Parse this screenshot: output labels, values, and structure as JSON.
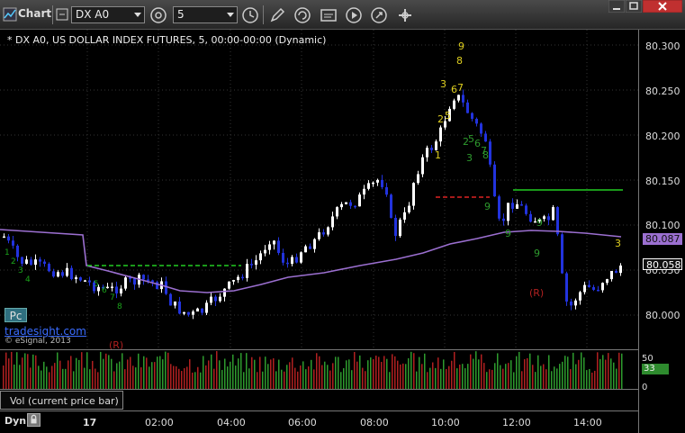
{
  "toolbar": {
    "title": "Chart",
    "symbol": "DX A0",
    "interval": "5"
  },
  "chart": {
    "header": "* DX A0, US DOLLAR INDEX FUTURES, 5, 00:00-00:00 (Dynamic)",
    "price_labels": [
      "80.300",
      "80.250",
      "80.200",
      "80.150",
      "80.100",
      "80.050",
      "80.000"
    ],
    "last_price_tag": "80.058",
    "ma_price_tag": "80.087",
    "pc_label": "Pc",
    "brand_link": "tradesight.com",
    "brand_copy": "© eSignal, 2013",
    "markers": [
      {
        "text": "9",
        "color": "#e0d020"
      },
      {
        "text": "8",
        "color": "#e0d020"
      },
      {
        "text": "3",
        "color": "#e0d020"
      },
      {
        "text": "6",
        "color": "#e0d020"
      },
      {
        "text": "7",
        "color": "#e0d020"
      },
      {
        "text": "2",
        "color": "#e0d020"
      },
      {
        "text": "5",
        "color": "#e0d020"
      },
      {
        "text": "1",
        "color": "#e0d020"
      },
      {
        "text": "2",
        "color": "#2e9b2e"
      },
      {
        "text": "5",
        "color": "#2e9b2e"
      },
      {
        "text": "6",
        "color": "#2e9b2e"
      },
      {
        "text": "7",
        "color": "#2e9b2e"
      },
      {
        "text": "8",
        "color": "#2e9b2e"
      },
      {
        "text": "3",
        "color": "#2e9b2e"
      },
      {
        "text": "9",
        "color": "#2e9b2e"
      },
      {
        "text": "9",
        "color": "#2e9b2e"
      },
      {
        "text": "9",
        "color": "#2e9b2e"
      },
      {
        "text": "9",
        "color": "#2e9b2e"
      },
      {
        "text": "3",
        "color": "#e0d020"
      },
      {
        "text": "(R)",
        "color": "#b02020"
      },
      {
        "text": "(R)",
        "color": "#b02020"
      }
    ]
  },
  "volume": {
    "label": "Vol (current price bar)",
    "scale": [
      "50",
      "0"
    ],
    "current": "33"
  },
  "time_axis": {
    "labels": [
      "17",
      "02:00",
      "04:00",
      "06:00",
      "08:00",
      "10:00",
      "12:00",
      "14:00"
    ],
    "dyn_label": "Dyn"
  },
  "colors": {
    "up_candle": "#ffffff",
    "down_candle": "#2233dd",
    "ma_line": "#9b6fd0",
    "support_line": "#22cc22",
    "resistance_line": "#dd2222",
    "volume_up": "#2e9b2e",
    "volume_down": "#b02020"
  }
}
